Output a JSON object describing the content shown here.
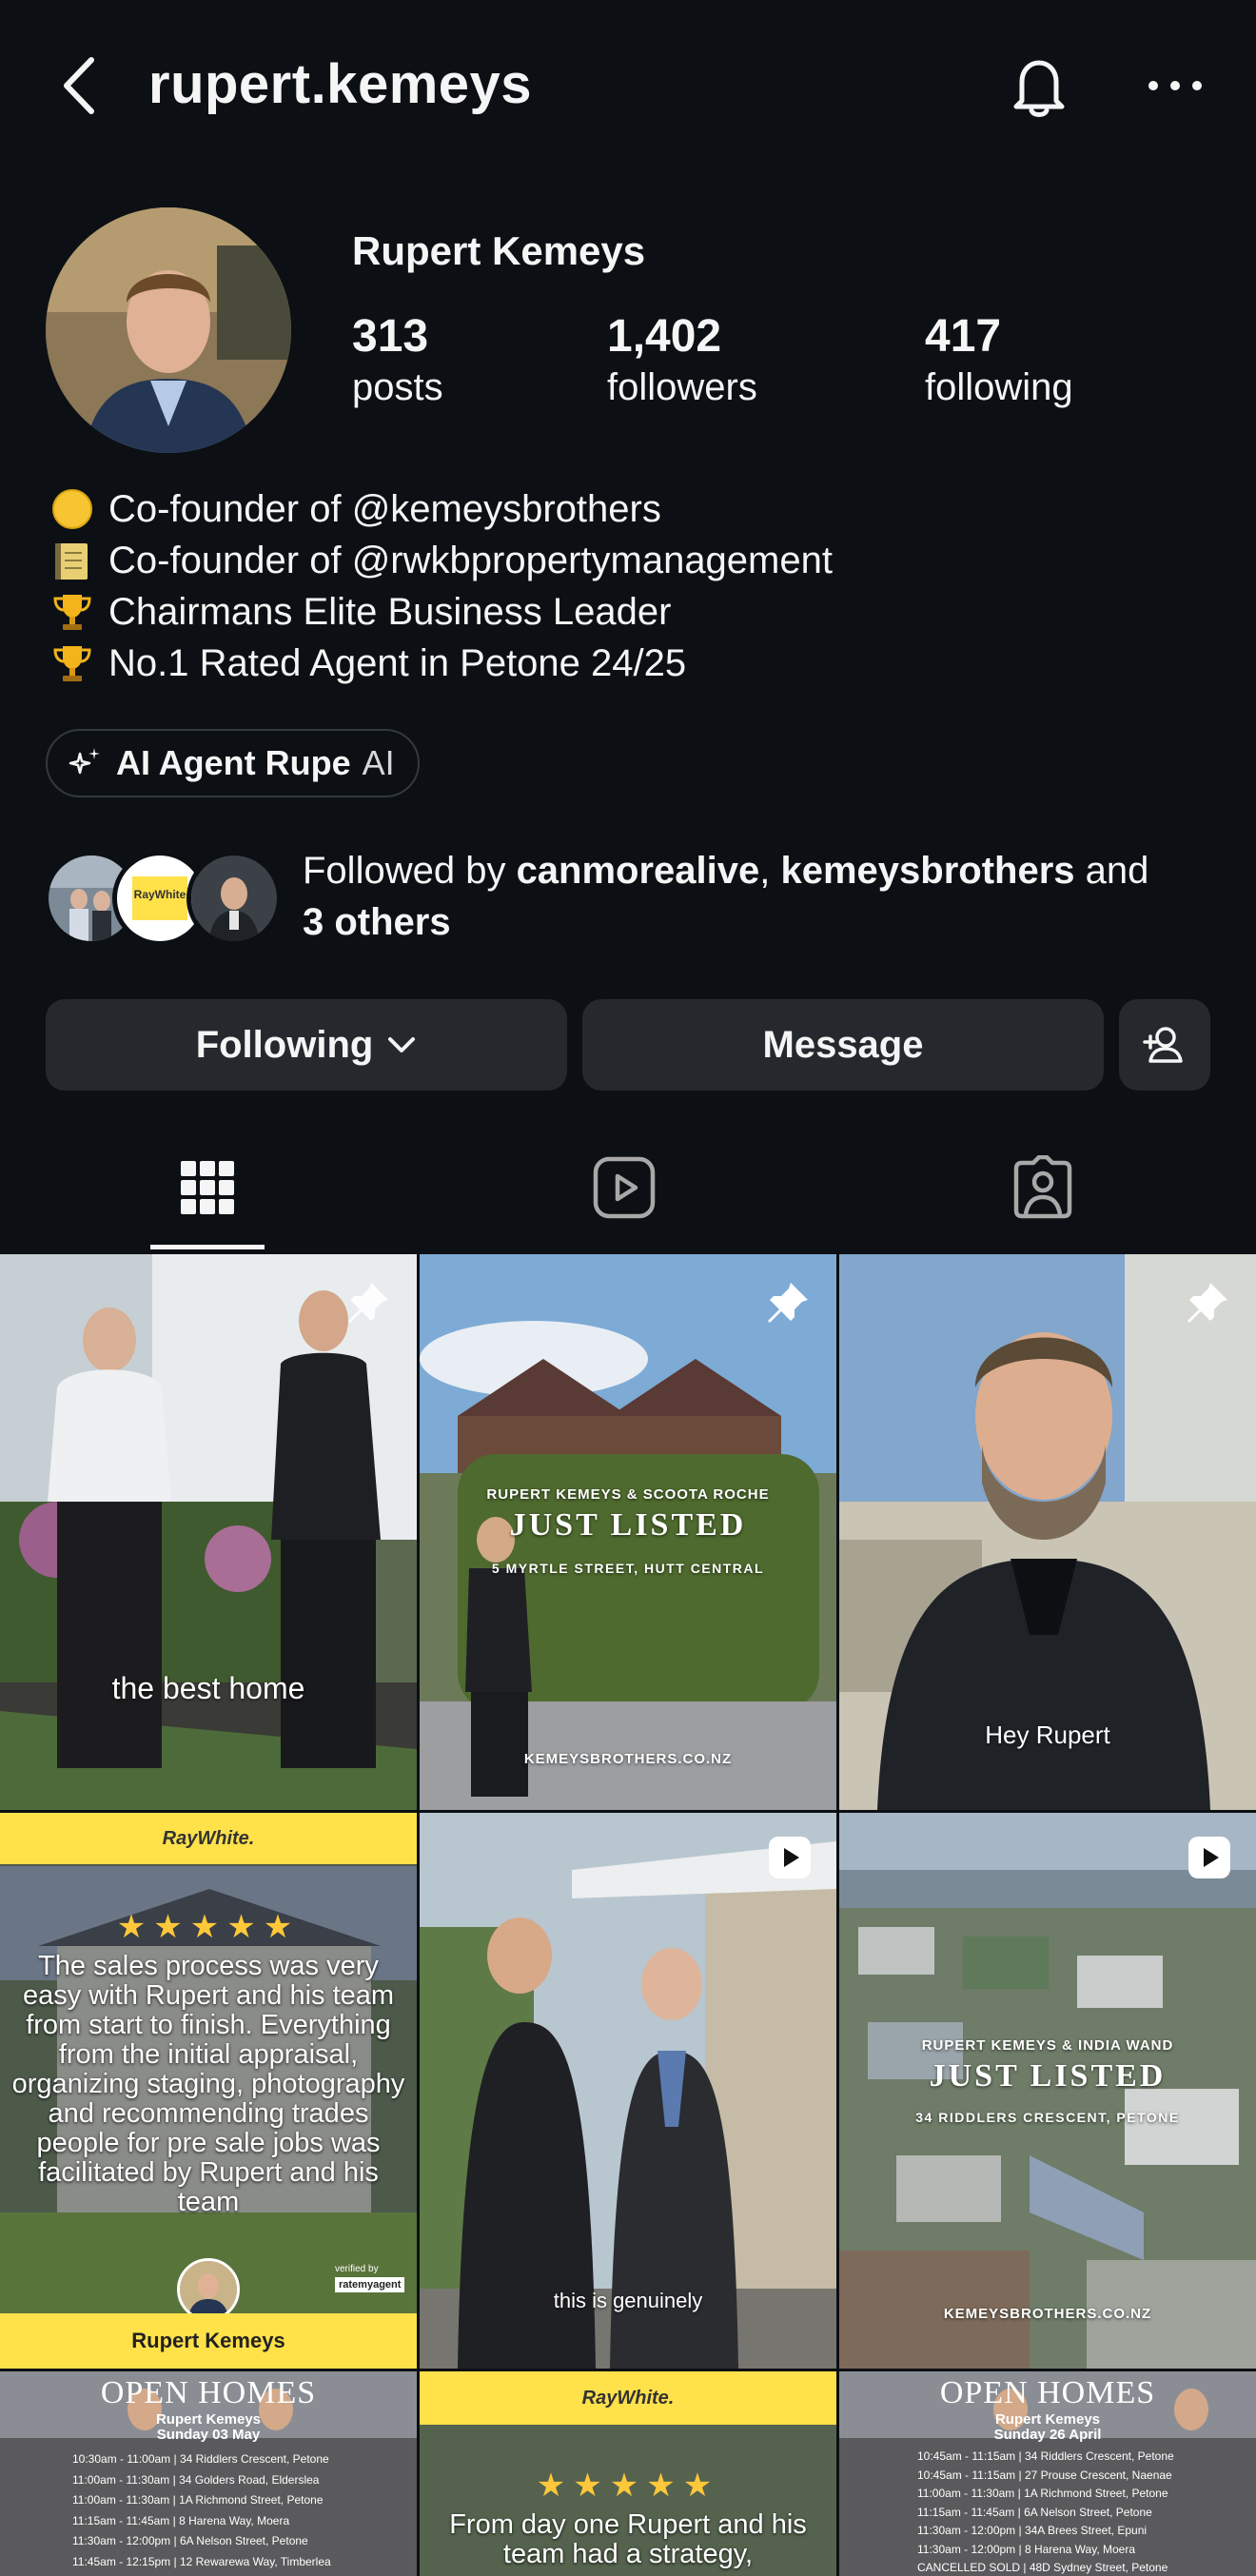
{
  "header": {
    "username": "rupert.kemeys"
  },
  "profile": {
    "display_name": "Rupert Kemeys",
    "stats": {
      "posts": {
        "value": "313",
        "label": "posts"
      },
      "followers": {
        "value": "1,402",
        "label": "followers"
      },
      "following": {
        "value": "417",
        "label": "following"
      }
    },
    "bio": [
      {
        "icon": "yellow-circle-emoji",
        "text": "Co-founder of @kemeysbrothers"
      },
      {
        "icon": "notepad-emoji",
        "text": "Co-founder of @rwkbpropertymanagement"
      },
      {
        "icon": "trophy-emoji",
        "text": "Chairmans Elite Business Leader"
      },
      {
        "icon": "trophy-emoji",
        "text": "No.1 Rated Agent in Petone 24/25"
      }
    ],
    "ai_chip": {
      "name": "AI Agent Rupe",
      "tag": "AI"
    },
    "followed_by": {
      "prefix": "Followed by ",
      "user1": "canmorealive",
      "sep": ", ",
      "user2": "kemeysbrothers",
      "and": " and",
      "others": "3 others",
      "avatar_badge": "RayWhite"
    }
  },
  "actions": {
    "following_label": "Following",
    "message_label": "Message"
  },
  "tabs": [
    {
      "name": "grid",
      "active": true
    },
    {
      "name": "reels",
      "active": false
    },
    {
      "name": "tagged",
      "active": false
    }
  ],
  "posts": {
    "p1": {
      "caption": "the best home"
    },
    "p2": {
      "top": "RUPERT KEMEYS & SCOOTA ROCHE",
      "headline": "JUST LISTED",
      "address": "5 MYRTLE STREET, HUTT CENTRAL",
      "site": "KEMEYSBROTHERS.CO.NZ"
    },
    "p3": {
      "caption": "Hey Rupert"
    },
    "p4": {
      "brand": "RayWhite.",
      "stars": "★★★★★",
      "review": "The sales process was very easy with Rupert and his team from start to finish. Everything from the initial appraisal, organizing staging, photography and recommending trades people for pre sale jobs was facilitated by Rupert and his team",
      "verified": "verified by",
      "verified_brand": "ratemyagent",
      "name": "Rupert Kemeys"
    },
    "p5": {
      "caption": "this is genuinely"
    },
    "p6": {
      "top": "RUPERT KEMEYS & INDIA WAND",
      "headline": "JUST LISTED",
      "address": "34 RIDDLERS CRESCENT, PETONE",
      "site": "KEMEYSBROTHERS.CO.NZ"
    },
    "p7": {
      "title": "OPEN HOMES",
      "name": "Rupert Kemeys",
      "date": "Sunday 03 May",
      "rows": [
        "10:30am - 11:00am | 34 Riddlers Crescent, Petone",
        "11:00am - 11:30am | 34 Golders Road, Elderslea",
        "11:00am - 11:30am | 1A Richmond Street, Petone",
        "11:15am - 11:45am | 8 Harena Way, Moera",
        "11:30am - 12:00pm | 6A Nelson Street, Petone",
        "11:45am - 12:15pm | 12 Rewarewa Way, Timberlea"
      ]
    },
    "p8": {
      "brand": "RayWhite.",
      "stars": "★★★★★",
      "review": "From day one Rupert and his team had a strategy,"
    },
    "p9": {
      "title": "OPEN HOMES",
      "name": "Rupert Kemeys",
      "date": "Sunday 26 April",
      "rows": [
        "10:45am - 11:15am | 34 Riddlers Crescent, Petone",
        "10:45am - 11:15am | 27 Prouse Crescent, Naenae",
        "11:00am - 11:30am | 1A Richmond Street, Petone",
        "11:15am - 11:45am | 6A Nelson Street, Petone",
        "11:30am - 12:00pm | 34A Brees Street, Epuni",
        "11:30am - 12:00pm | 8 Harena Way, Moera",
        "CANCELLED SOLD | 48D Sydney Street, Petone"
      ]
    }
  }
}
